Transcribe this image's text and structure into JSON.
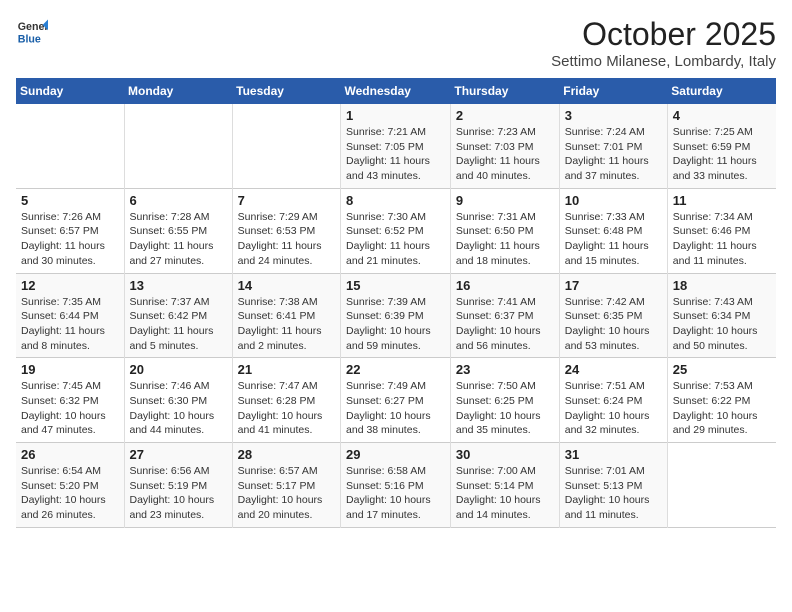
{
  "header": {
    "logo_general": "General",
    "logo_blue": "Blue",
    "title": "October 2025",
    "subtitle": "Settimo Milanese, Lombardy, Italy"
  },
  "weekdays": [
    "Sunday",
    "Monday",
    "Tuesday",
    "Wednesday",
    "Thursday",
    "Friday",
    "Saturday"
  ],
  "weeks": [
    [
      {
        "day": "",
        "info": ""
      },
      {
        "day": "",
        "info": ""
      },
      {
        "day": "",
        "info": ""
      },
      {
        "day": "1",
        "info": "Sunrise: 7:21 AM\nSunset: 7:05 PM\nDaylight: 11 hours and 43 minutes."
      },
      {
        "day": "2",
        "info": "Sunrise: 7:23 AM\nSunset: 7:03 PM\nDaylight: 11 hours and 40 minutes."
      },
      {
        "day": "3",
        "info": "Sunrise: 7:24 AM\nSunset: 7:01 PM\nDaylight: 11 hours and 37 minutes."
      },
      {
        "day": "4",
        "info": "Sunrise: 7:25 AM\nSunset: 6:59 PM\nDaylight: 11 hours and 33 minutes."
      }
    ],
    [
      {
        "day": "5",
        "info": "Sunrise: 7:26 AM\nSunset: 6:57 PM\nDaylight: 11 hours and 30 minutes."
      },
      {
        "day": "6",
        "info": "Sunrise: 7:28 AM\nSunset: 6:55 PM\nDaylight: 11 hours and 27 minutes."
      },
      {
        "day": "7",
        "info": "Sunrise: 7:29 AM\nSunset: 6:53 PM\nDaylight: 11 hours and 24 minutes."
      },
      {
        "day": "8",
        "info": "Sunrise: 7:30 AM\nSunset: 6:52 PM\nDaylight: 11 hours and 21 minutes."
      },
      {
        "day": "9",
        "info": "Sunrise: 7:31 AM\nSunset: 6:50 PM\nDaylight: 11 hours and 18 minutes."
      },
      {
        "day": "10",
        "info": "Sunrise: 7:33 AM\nSunset: 6:48 PM\nDaylight: 11 hours and 15 minutes."
      },
      {
        "day": "11",
        "info": "Sunrise: 7:34 AM\nSunset: 6:46 PM\nDaylight: 11 hours and 11 minutes."
      }
    ],
    [
      {
        "day": "12",
        "info": "Sunrise: 7:35 AM\nSunset: 6:44 PM\nDaylight: 11 hours and 8 minutes."
      },
      {
        "day": "13",
        "info": "Sunrise: 7:37 AM\nSunset: 6:42 PM\nDaylight: 11 hours and 5 minutes."
      },
      {
        "day": "14",
        "info": "Sunrise: 7:38 AM\nSunset: 6:41 PM\nDaylight: 11 hours and 2 minutes."
      },
      {
        "day": "15",
        "info": "Sunrise: 7:39 AM\nSunset: 6:39 PM\nDaylight: 10 hours and 59 minutes."
      },
      {
        "day": "16",
        "info": "Sunrise: 7:41 AM\nSunset: 6:37 PM\nDaylight: 10 hours and 56 minutes."
      },
      {
        "day": "17",
        "info": "Sunrise: 7:42 AM\nSunset: 6:35 PM\nDaylight: 10 hours and 53 minutes."
      },
      {
        "day": "18",
        "info": "Sunrise: 7:43 AM\nSunset: 6:34 PM\nDaylight: 10 hours and 50 minutes."
      }
    ],
    [
      {
        "day": "19",
        "info": "Sunrise: 7:45 AM\nSunset: 6:32 PM\nDaylight: 10 hours and 47 minutes."
      },
      {
        "day": "20",
        "info": "Sunrise: 7:46 AM\nSunset: 6:30 PM\nDaylight: 10 hours and 44 minutes."
      },
      {
        "day": "21",
        "info": "Sunrise: 7:47 AM\nSunset: 6:28 PM\nDaylight: 10 hours and 41 minutes."
      },
      {
        "day": "22",
        "info": "Sunrise: 7:49 AM\nSunset: 6:27 PM\nDaylight: 10 hours and 38 minutes."
      },
      {
        "day": "23",
        "info": "Sunrise: 7:50 AM\nSunset: 6:25 PM\nDaylight: 10 hours and 35 minutes."
      },
      {
        "day": "24",
        "info": "Sunrise: 7:51 AM\nSunset: 6:24 PM\nDaylight: 10 hours and 32 minutes."
      },
      {
        "day": "25",
        "info": "Sunrise: 7:53 AM\nSunset: 6:22 PM\nDaylight: 10 hours and 29 minutes."
      }
    ],
    [
      {
        "day": "26",
        "info": "Sunrise: 6:54 AM\nSunset: 5:20 PM\nDaylight: 10 hours and 26 minutes."
      },
      {
        "day": "27",
        "info": "Sunrise: 6:56 AM\nSunset: 5:19 PM\nDaylight: 10 hours and 23 minutes."
      },
      {
        "day": "28",
        "info": "Sunrise: 6:57 AM\nSunset: 5:17 PM\nDaylight: 10 hours and 20 minutes."
      },
      {
        "day": "29",
        "info": "Sunrise: 6:58 AM\nSunset: 5:16 PM\nDaylight: 10 hours and 17 minutes."
      },
      {
        "day": "30",
        "info": "Sunrise: 7:00 AM\nSunset: 5:14 PM\nDaylight: 10 hours and 14 minutes."
      },
      {
        "day": "31",
        "info": "Sunrise: 7:01 AM\nSunset: 5:13 PM\nDaylight: 10 hours and 11 minutes."
      },
      {
        "day": "",
        "info": ""
      }
    ]
  ]
}
